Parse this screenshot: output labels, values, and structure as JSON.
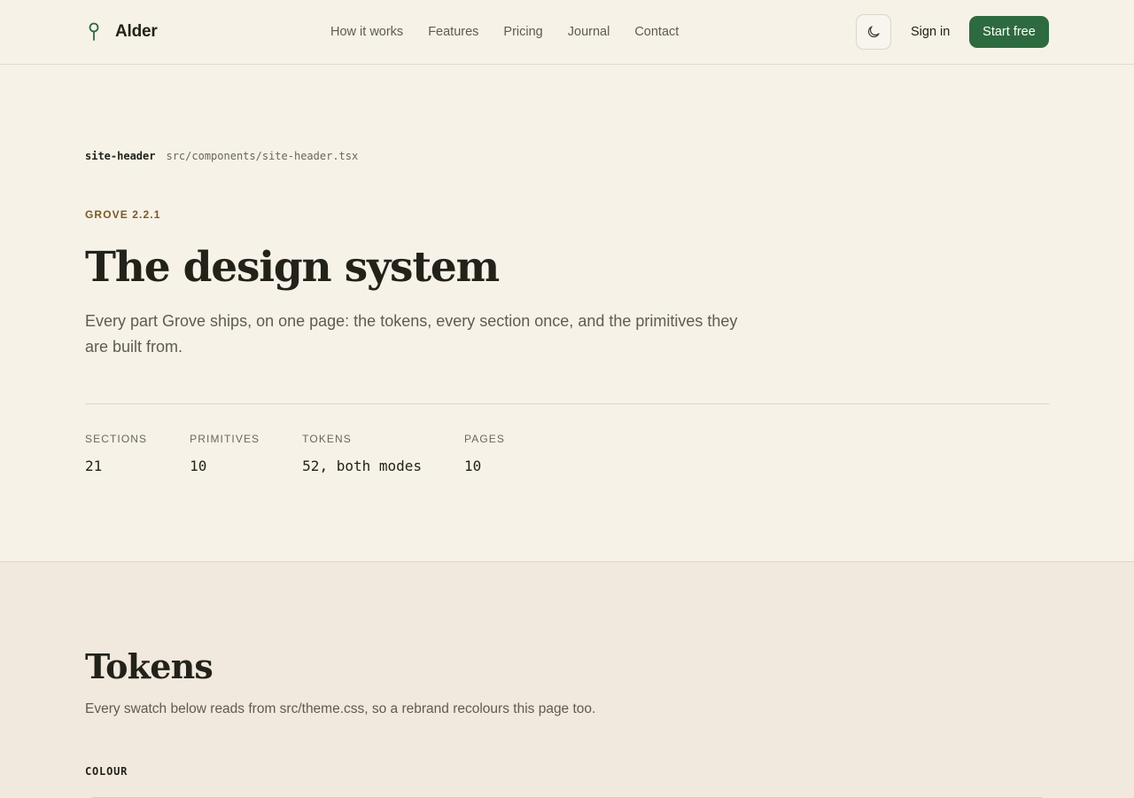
{
  "header": {
    "brand": "Alder",
    "nav": [
      "How it works",
      "Features",
      "Pricing",
      "Journal",
      "Contact"
    ],
    "theme_toggle_icon": "moon-icon",
    "sign_in": "Sign in",
    "cta": "Start free",
    "colors": {
      "accent": "#2e6a3f"
    }
  },
  "hero": {
    "component_name": "site-header",
    "component_path": "src/components/site-header.tsx",
    "version": "GROVE 2.2.1",
    "title": "The design system",
    "lede": "Every part Grove ships, on one page: the tokens, every section once, and the primitives they are built from.",
    "stats": [
      {
        "label": "SECTIONS",
        "value": "21"
      },
      {
        "label": "PRIMITIVES",
        "value": "10"
      },
      {
        "label": "TOKENS",
        "value": "52, both modes"
      },
      {
        "label": "PAGES",
        "value": "10"
      }
    ]
  },
  "tokens": {
    "title": "Tokens",
    "description": "Every swatch below reads from src/theme.css, so a rebrand recolours this page too.",
    "colour_heading": "COLOUR"
  }
}
